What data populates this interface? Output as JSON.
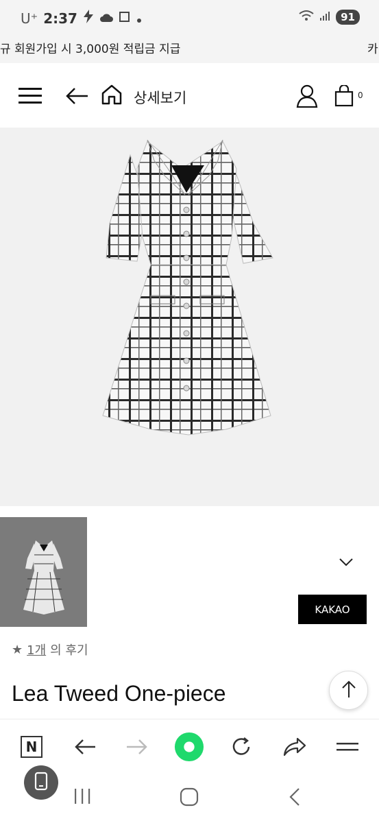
{
  "status_bar": {
    "carrier": "U⁺",
    "time": "2:37",
    "battery": "91"
  },
  "banner": {
    "text": "규 회원가입 시 3,000원 적립금 지급",
    "text_cut": "카"
  },
  "header": {
    "title": "상세보기",
    "cart_count": "0"
  },
  "icons": {
    "menu": "hamburger-menu-icon",
    "back": "arrow-left-icon",
    "home": "home-icon",
    "account": "user-icon",
    "cart": "shopping-bag-icon"
  },
  "product": {
    "kakao_label": "KAKAO",
    "review_star": "★",
    "review_count": "1개",
    "review_suffix": "의 후기",
    "name": "Lea Tweed One-piece"
  },
  "colors": {
    "accent_green": "#1fd96c",
    "kakao_bg": "#000000",
    "thumb_bg": "#7b7b7b"
  }
}
